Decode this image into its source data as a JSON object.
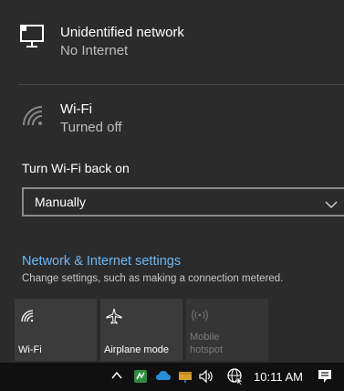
{
  "networks": [
    {
      "name": "Unidentified network",
      "status": "No Internet",
      "icon": "ethernet-monitor-icon"
    },
    {
      "name": "Wi-Fi",
      "status": "Turned off",
      "icon": "wifi-off-icon"
    }
  ],
  "wifi_back_on": {
    "label": "Turn Wi-Fi back on",
    "selected": "Manually",
    "icon": "chevron-down-icon"
  },
  "settings": {
    "link": "Network & Internet settings",
    "description": "Change settings, such as making a connection metered."
  },
  "tiles": [
    {
      "label": "Wi-Fi",
      "icon": "wifi-icon",
      "enabled": true
    },
    {
      "label": "Airplane mode",
      "icon": "airplane-icon",
      "enabled": true
    },
    {
      "label": "Mobile hotspot",
      "label_line1": "Mobile",
      "label_line2": "hotspot",
      "icon": "hotspot-icon",
      "enabled": false
    }
  ],
  "taskbar": {
    "time": "10:11 AM",
    "icons": [
      "chevron-up-icon",
      "green-app-icon",
      "onedrive-icon",
      "network-drive-icon",
      "volume-icon",
      "network-globe-icon",
      "notifications-icon"
    ]
  },
  "colors": {
    "accent": "#6fb8f5",
    "panel": "#2b2b2b",
    "tile_active": "#3b3b3b",
    "tile_disabled": "#353535",
    "taskbar": "#101010"
  }
}
